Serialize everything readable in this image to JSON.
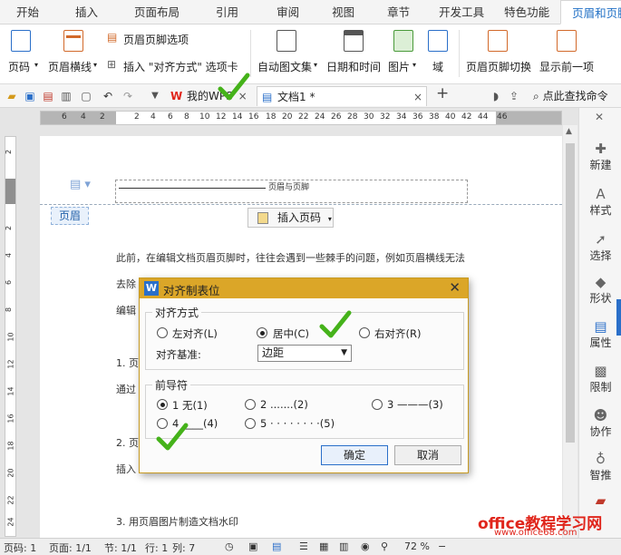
{
  "menu_tabs": [
    "开始",
    "插入",
    "页面布局",
    "引用",
    "审阅",
    "视图",
    "章节",
    "开发工具",
    "特色功能",
    "页眉和页脚"
  ],
  "active_tab": "页眉和页脚",
  "ribbon": {
    "page_number": "页码",
    "header_line": "页眉横线",
    "header_footer_options": "页眉页脚选项",
    "insert_align_tab": "插入 \"对齐方式\" 选项卡",
    "auto_text": "自动图文集",
    "date_time": "日期和时间",
    "picture": "图片",
    "field": "域",
    "switch_header_footer": "页眉页脚切换",
    "show_previous": "显示前一项"
  },
  "quickbar": {
    "tab_mywps": "我的WPS",
    "tab_doc": "文档1 *",
    "search": "点此查找命令"
  },
  "ruler_labels": [
    "6",
    "4",
    "2",
    "2",
    "4",
    "6",
    "8",
    "10",
    "12",
    "14",
    "16",
    "18",
    "20",
    "22",
    "24",
    "26",
    "28",
    "30",
    "32",
    "34",
    "36",
    "38",
    "40",
    "42",
    "44",
    "46"
  ],
  "vruler_labels": [
    "2",
    "2",
    "4",
    "6",
    "8",
    "10",
    "12",
    "14",
    "16",
    "18",
    "20",
    "22",
    "24",
    "26"
  ],
  "document": {
    "header_text": "页眉与页脚",
    "header_tag": "页眉",
    "insert_page_number": "插入页码",
    "para1": "此前，在编辑文档页眉页脚时，往往会遇到一些棘手的问题，例如页眉横线无法",
    "para2": "去除",
    "para3": "编辑",
    "para4": "1. 页",
    "para5": "通过",
    "para6": "2. 页",
    "para7": "插入",
    "para8": "3. 用页眉图片制造文档水印"
  },
  "sidebar": [
    "新建",
    "样式",
    "选择",
    "形状",
    "属性",
    "限制",
    "协作",
    "智推"
  ],
  "dialog": {
    "title": "对齐制表位",
    "align_group": "对齐方式",
    "align_left": "左对齐(L)",
    "align_center": "居中(C)",
    "align_right": "右对齐(R)",
    "align_base_label": "对齐基准:",
    "align_base_value": "边距",
    "leader_group": "前导符",
    "leader1": "1 无(1)",
    "leader2": "2 .......(2)",
    "leader3": "3 ———(3)",
    "leader4": "4 ____(4)",
    "leader5": "5 · · · · · · · ·(5)",
    "ok": "确定",
    "cancel": "取消"
  },
  "statusbar": {
    "page_num": "页码: 1",
    "pages": "页面: 1/1",
    "section": "节: 1/1",
    "row": "行: 1",
    "col": "列: 7",
    "zoom": "72 %"
  },
  "watermark": {
    "line1": "office教程学习网",
    "line2": "www.office68.com"
  },
  "colors": {
    "accent": "#2a6fc9",
    "dialog_title": "#dba628",
    "check": "#45b21a",
    "watermark": "#e0251b"
  }
}
